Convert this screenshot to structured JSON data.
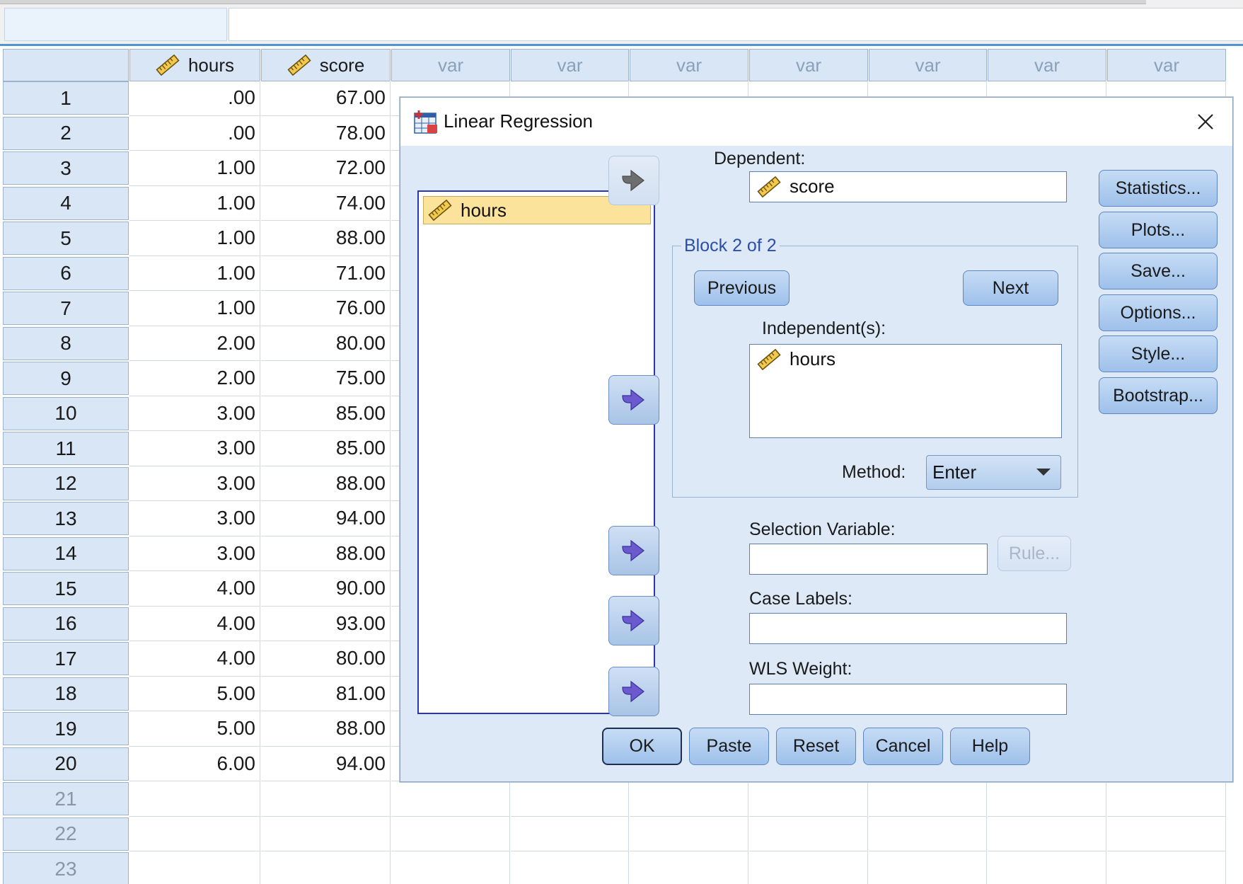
{
  "spreadsheet": {
    "columns": [
      "hours",
      "score",
      "var",
      "var",
      "var",
      "var",
      "var",
      "var",
      "var"
    ],
    "rows": [
      {
        "n": "1",
        "hours": ".00",
        "score": "67.00"
      },
      {
        "n": "2",
        "hours": ".00",
        "score": "78.00"
      },
      {
        "n": "3",
        "hours": "1.00",
        "score": "72.00"
      },
      {
        "n": "4",
        "hours": "1.00",
        "score": "74.00"
      },
      {
        "n": "5",
        "hours": "1.00",
        "score": "88.00"
      },
      {
        "n": "6",
        "hours": "1.00",
        "score": "71.00"
      },
      {
        "n": "7",
        "hours": "1.00",
        "score": "76.00"
      },
      {
        "n": "8",
        "hours": "2.00",
        "score": "80.00"
      },
      {
        "n": "9",
        "hours": "2.00",
        "score": "75.00"
      },
      {
        "n": "10",
        "hours": "3.00",
        "score": "85.00"
      },
      {
        "n": "11",
        "hours": "3.00",
        "score": "85.00"
      },
      {
        "n": "12",
        "hours": "3.00",
        "score": "88.00"
      },
      {
        "n": "13",
        "hours": "3.00",
        "score": "94.00"
      },
      {
        "n": "14",
        "hours": "3.00",
        "score": "88.00"
      },
      {
        "n": "15",
        "hours": "4.00",
        "score": "90.00"
      },
      {
        "n": "16",
        "hours": "4.00",
        "score": "93.00"
      },
      {
        "n": "17",
        "hours": "4.00",
        "score": "80.00"
      },
      {
        "n": "18",
        "hours": "5.00",
        "score": "81.00"
      },
      {
        "n": "19",
        "hours": "5.00",
        "score": "88.00"
      },
      {
        "n": "20",
        "hours": "6.00",
        "score": "94.00"
      }
    ],
    "empty_rows": [
      "21",
      "22",
      "23"
    ]
  },
  "dialog": {
    "title": "Linear Regression",
    "source_list": [
      "hours"
    ],
    "dependent_label": "Dependent:",
    "dependent_value": "score",
    "block_label": "Block 2 of 2",
    "previous_button": "Previous",
    "next_button": "Next",
    "independent_label": "Independent(s):",
    "independent_values": [
      "hours"
    ],
    "method_label": "Method:",
    "method_value": "Enter",
    "selection_variable_label": "Selection Variable:",
    "rule_button": "Rule...",
    "case_labels_label": "Case Labels:",
    "wls_weight_label": "WLS Weight:",
    "side_buttons": [
      "Statistics...",
      "Plots...",
      "Save...",
      "Options...",
      "Style...",
      "Bootstrap..."
    ],
    "bottom_buttons": [
      "OK",
      "Paste",
      "Reset",
      "Cancel",
      "Help"
    ]
  },
  "colors": {
    "accent": "#4f95d3",
    "dialog_bg": "#dde9f7",
    "selected_item": "#fbe39b",
    "list_border": "#2b35b5",
    "arrow_icon": "#6a5acd"
  },
  "icons": [
    "scale-ruler-icon",
    "regression-icon",
    "close-icon",
    "right-arrow-icon",
    "dropdown-caret-icon"
  ]
}
